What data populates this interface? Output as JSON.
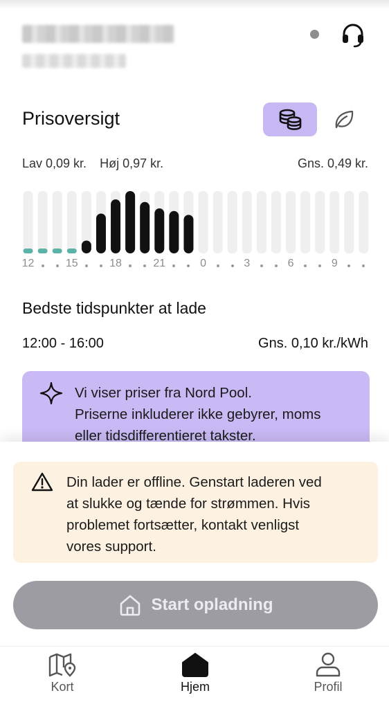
{
  "header": {
    "device_name": "",
    "status": "offline",
    "support_icon": "headset-icon"
  },
  "prices": {
    "title": "Prisoversigt",
    "mode_buttons": [
      {
        "icon": "coins-icon",
        "active": true
      },
      {
        "icon": "leaf-icon",
        "active": false
      }
    ],
    "low": "Lav 0,09 kr.",
    "high": "Høj 0,97 kr.",
    "avg": "Gns. 0,49 kr."
  },
  "chart_data": {
    "type": "bar",
    "x_tick_labels": [
      "12",
      "15",
      "18",
      "21",
      "0",
      "3",
      "6",
      "9"
    ],
    "hours": [
      12,
      13,
      14,
      15,
      16,
      17,
      18,
      19,
      20,
      21,
      22,
      23,
      0,
      1,
      2,
      3,
      4,
      5,
      6,
      7,
      8,
      9,
      10,
      11
    ],
    "values": [
      0.09,
      0.09,
      0.09,
      0.09,
      0.2,
      0.62,
      0.84,
      0.97,
      0.8,
      0.7,
      0.66,
      0.6,
      null,
      null,
      null,
      null,
      null,
      null,
      null,
      null,
      null,
      null,
      null,
      null
    ],
    "cheapest_hours": [
      12,
      13,
      14,
      15
    ],
    "unit": "kr./kWh",
    "colors": {
      "cheap": "#5bb2a6",
      "normal": "#111111",
      "track": "#efefef"
    }
  },
  "best_time": {
    "title": "Bedste tidspunkter at lade",
    "range": "12:00 - 16:00",
    "avg": "Gns. 0,10 kr./kWh"
  },
  "info": {
    "icon": "sparkle-icon",
    "lines": [
      "Vi viser priser fra Nord Pool.",
      "Priserne inkluderer ikke gebyrer, moms",
      "eller tidsdifferentieret takster."
    ]
  },
  "warning": {
    "icon": "warning-triangle-icon",
    "lines": [
      "Din lader er offline. Genstart laderen ved",
      "at slukke og tænde for strømmen. Hvis",
      "problemet fortsætter, kontakt venligst",
      "vores support."
    ]
  },
  "start_button": {
    "label": "Start opladning",
    "icon": "home-icon",
    "enabled": false
  },
  "nav": {
    "items": [
      {
        "label": "Kort",
        "icon": "map-pin-icon",
        "active": false
      },
      {
        "label": "Hjem",
        "icon": "home-filled-icon",
        "active": true
      },
      {
        "label": "Profil",
        "icon": "user-icon",
        "active": false
      }
    ]
  },
  "colors": {
    "accent": "#c7b7f3",
    "warning_bg": "#fdf2e1",
    "button_disabled": "#9d9ca3"
  }
}
